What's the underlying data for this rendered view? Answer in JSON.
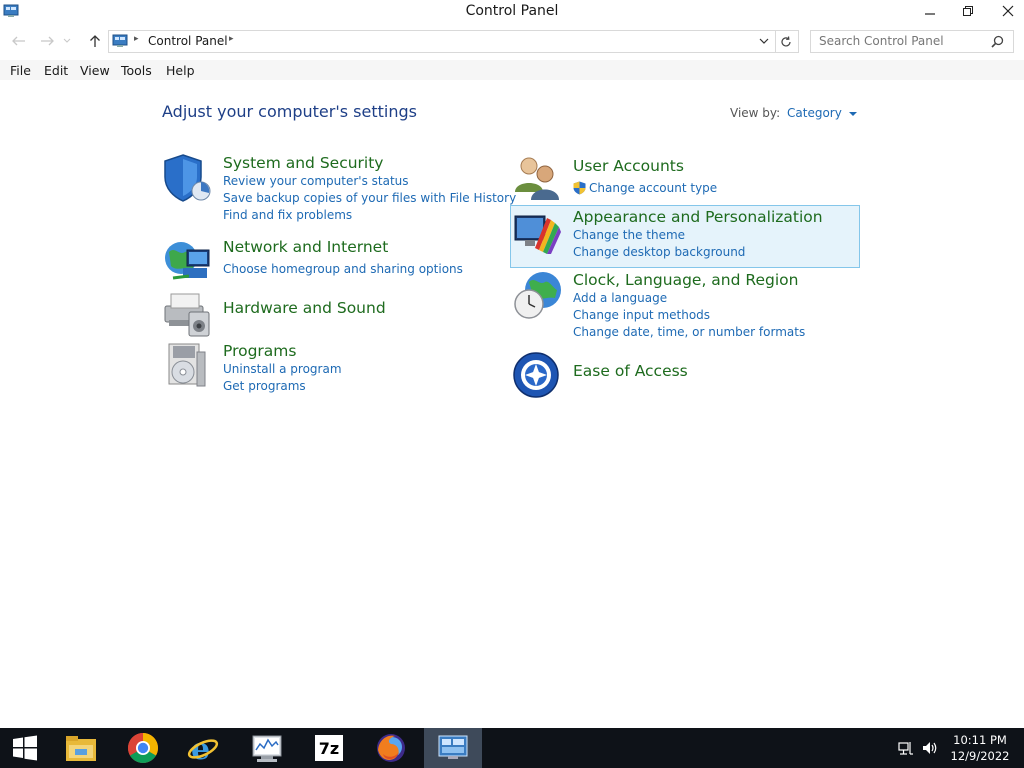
{
  "window": {
    "title": "Control Panel"
  },
  "address": {
    "path": "Control Panel",
    "search_placeholder": "Search Control Panel"
  },
  "menu": [
    "File",
    "Edit",
    "View",
    "Tools",
    "Help"
  ],
  "main": {
    "title": "Adjust your computer's settings",
    "view_by_label": "View by:",
    "view_by_value": "Category"
  },
  "categories_left": [
    {
      "title": "System and Security",
      "links": [
        "Review your computer's status",
        "Save backup copies of your files with File History",
        "Find and fix problems"
      ]
    },
    {
      "title": "Network and Internet",
      "links": [
        "Choose homegroup and sharing options"
      ]
    },
    {
      "title": "Hardware and Sound",
      "links": []
    },
    {
      "title": "Programs",
      "links": [
        "Uninstall a program",
        "Get programs"
      ]
    }
  ],
  "categories_right": [
    {
      "title": "User Accounts",
      "links": [
        "Change account type"
      ]
    },
    {
      "title": "Appearance and Personalization",
      "links": [
        "Change the theme",
        "Change desktop background"
      ]
    },
    {
      "title": "Clock, Language, and Region",
      "links": [
        "Add a language",
        "Change input methods",
        "Change date, time, or number formats"
      ]
    },
    {
      "title": "Ease of Access",
      "links": []
    }
  ],
  "taskbar": {
    "icons": [
      "start-icon",
      "file-explorer-icon",
      "chrome-icon",
      "internet-explorer-icon",
      "performance-monitor-icon",
      "7zip-icon",
      "firefox-icon",
      "control-panel-icon"
    ],
    "sevenzip_label": "7z",
    "clock_time": "10:11 PM",
    "clock_date": "12/9/2022"
  },
  "colors": {
    "link": "#1e6ab4",
    "category_title": "#1e6b1e",
    "page_title": "#1e3f87",
    "highlight": "#e5f3fb",
    "taskbar": "#0e1218"
  }
}
